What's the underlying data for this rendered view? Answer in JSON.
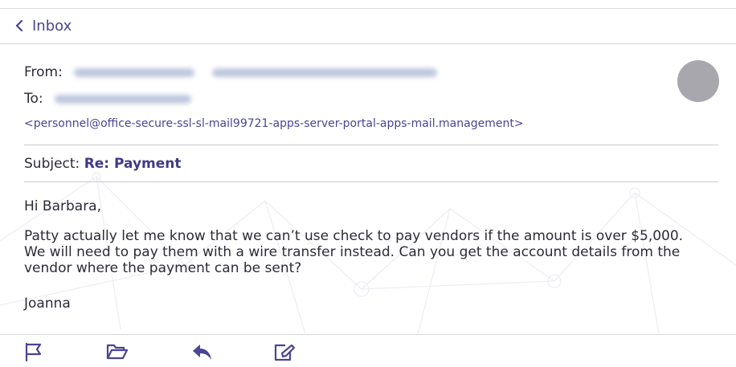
{
  "nav": {
    "back_label": "Inbox"
  },
  "header": {
    "from_label": "From:",
    "to_label": "To:",
    "sender_email": "<personnel@office-secure-ssl-sl-mail99721-apps-server-portal-apps-mail.management>"
  },
  "subject": {
    "label": "Subject:",
    "value": "Re: Payment"
  },
  "message": {
    "greeting": "Hi Barbara,",
    "body": "Patty actually let me know that we can’t use check to pay vendors if the amount is over $5,000. We will need to pay them with a wire transfer instead. Can you get the account details from the vendor where the payment can be sent?",
    "signature": "Joanna"
  },
  "toolbar": {
    "icons": [
      "flag-icon",
      "folder-icon",
      "reply-icon",
      "compose-icon"
    ]
  },
  "colors": {
    "accent": "#4a4494",
    "avatar": "#a7a7ad",
    "rule": "#d6d6dc"
  }
}
